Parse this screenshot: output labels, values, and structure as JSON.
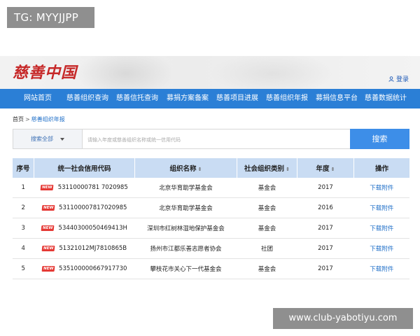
{
  "overlay_top": "TG: MYYJJPP",
  "overlay_bottom": "www.club-yabotiyu.com",
  "header": {
    "logo": "慈善中国",
    "login": "登录"
  },
  "nav": [
    "网站首页",
    "慈善组织查询",
    "慈善信托查询",
    "募捐方案备案",
    "慈善项目进展",
    "慈善组织年报",
    "募捐信息平台",
    "慈善数据统计"
  ],
  "breadcrumb": {
    "home": "首页",
    "separator": ">",
    "current": "慈善组织年报"
  },
  "search": {
    "scope": "搜索全部",
    "placeholder": "请输入年度或慈善组织名称或统一信用代码",
    "button": "搜索"
  },
  "table": {
    "headers": [
      "序号",
      "统一社会信用代码",
      "组织名称",
      "社会组织类别",
      "年度",
      "操作"
    ],
    "badge": "NEW",
    "rows": [
      {
        "no": "1",
        "code": "53110000781 7020985",
        "name": "北京华育助学基金会",
        "category": "基金会",
        "year": "2017",
        "action": "下载附件"
      },
      {
        "no": "2",
        "code": "531100007817020985",
        "name": "北京华育助学基金会",
        "category": "基金会",
        "year": "2016",
        "action": "下载附件"
      },
      {
        "no": "3",
        "code": "53440300050469413H",
        "name": "深圳市红树林湿地保护基金会",
        "category": "基金会",
        "year": "2017",
        "action": "下载附件"
      },
      {
        "no": "4",
        "code": "51321012MJ7810865B",
        "name": "扬州市江都乐善志愿者协会",
        "category": "社团",
        "year": "2017",
        "action": "下载附件"
      },
      {
        "no": "5",
        "code": "535100000667917730",
        "name": "攀枝花市关心下一代基金会",
        "category": "基金会",
        "year": "2017",
        "action": "下载附件"
      }
    ]
  }
}
